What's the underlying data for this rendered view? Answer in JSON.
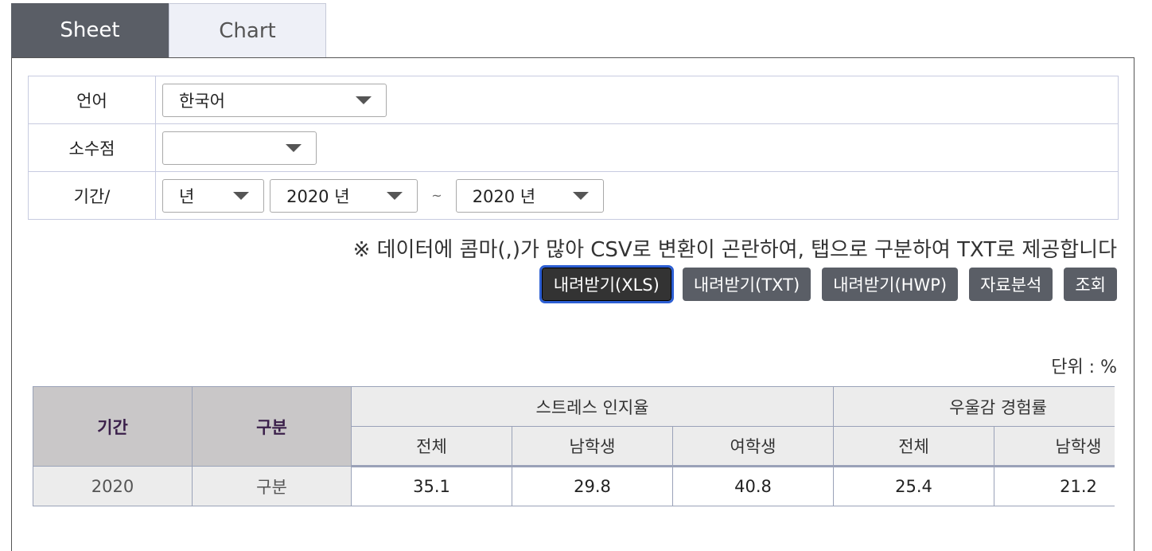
{
  "tabs": {
    "sheet": "Sheet",
    "chart": "Chart"
  },
  "form": {
    "language_label": "언어",
    "language_value": "한국어",
    "decimal_label": "소수점",
    "decimal_value": "",
    "period_label": "기간/",
    "period_unit": "년",
    "period_start": "2020 년",
    "period_tilde": "~",
    "period_end": "2020 년"
  },
  "notice": "※ 데이터에 콤마(,)가 많아 CSV로 변환이 곤란하여, 탭으로 구분하여 TXT로 제공합니다",
  "buttons": {
    "xls": "내려받기(XLS)",
    "txt": "내려받기(TXT)",
    "hwp": "내려받기(HWP)",
    "analysis": "자료분석",
    "search": "조회"
  },
  "unit": "단위 : %",
  "table": {
    "col_period": "기간",
    "col_category": "구분",
    "group1": "스트레스 인지율",
    "group2": "우울감 경험률",
    "sub": [
      "전체",
      "남학생",
      "여학생",
      "전체",
      "남학생"
    ],
    "rows": [
      {
        "period": "2020",
        "category": "구분",
        "values": [
          "35.1",
          "29.8",
          "40.8",
          "25.4",
          "21.2"
        ]
      }
    ]
  }
}
